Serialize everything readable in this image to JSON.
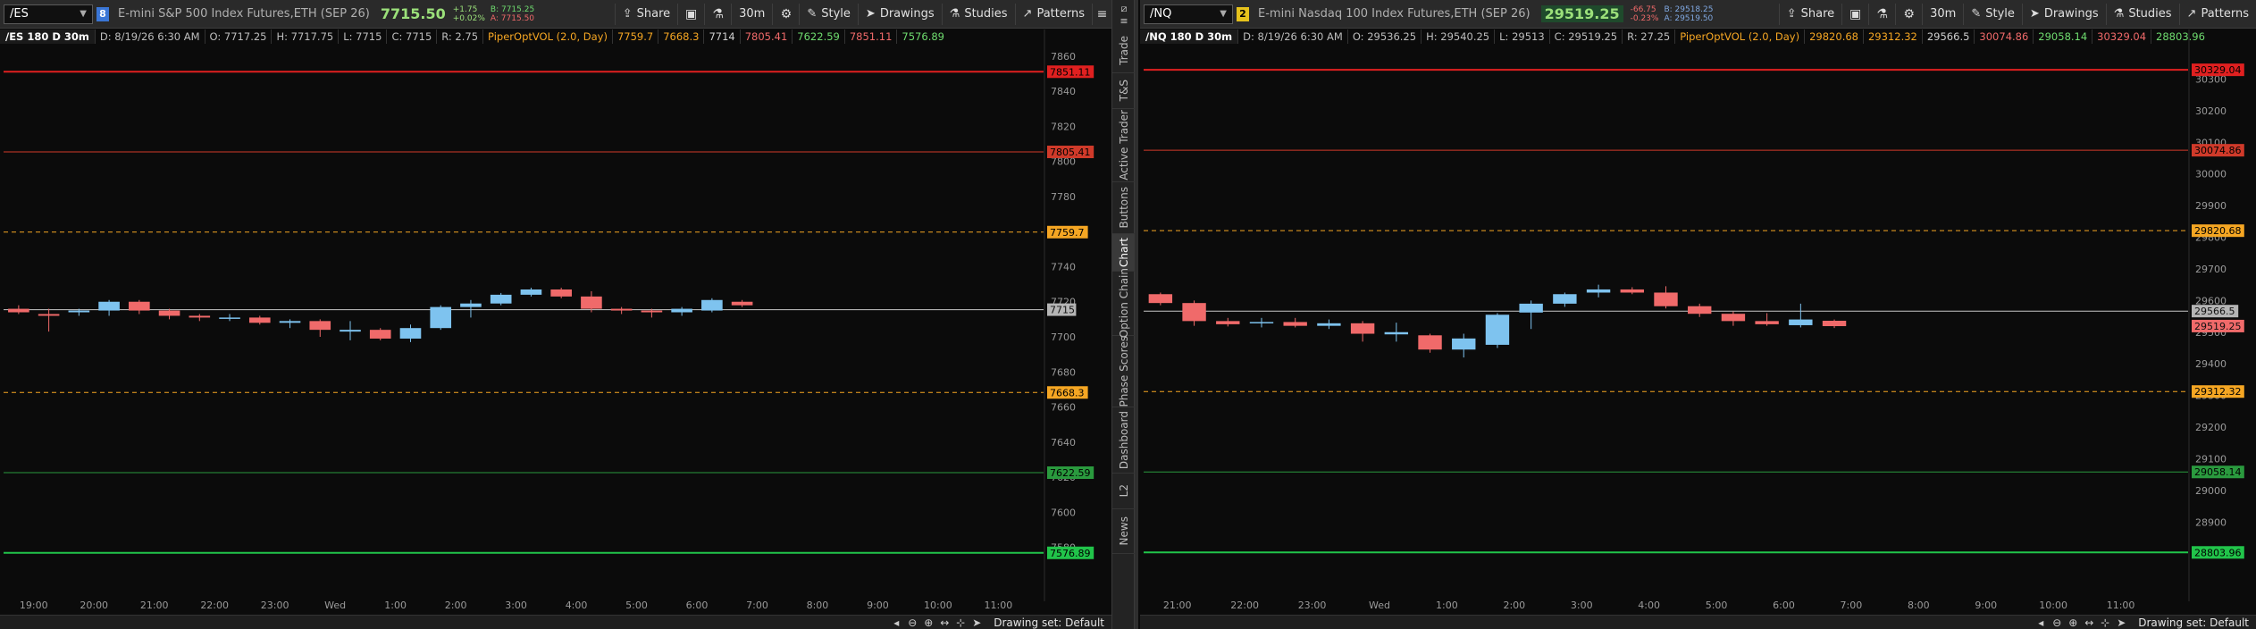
{
  "colors": {
    "up": "#7ec3ef",
    "down": "#f06a6a",
    "red_level": "#e02020",
    "orange_level": "#f5a623",
    "green_level": "#21c44a",
    "last_line": "#c8c8c8"
  },
  "charts": [
    {
      "id": "es",
      "symbol": "/ES",
      "link_badge": "8",
      "link_color": "#3a76d6",
      "description": "E-mini S&P 500 Index Futures,ETH (SEP 26)",
      "last_price": "7715.50",
      "net_change": "+1.75",
      "net_change_pct": "+0.02%",
      "bid": "B: 7715.25",
      "ask": "A: 7715.50",
      "timeframe": "30m",
      "share_label": "Share",
      "style_label": "Style",
      "drawings_label": "Drawings",
      "studies_label": "Studies",
      "patterns_label": "Patterns",
      "info": {
        "title": "/ES 180 D 30m",
        "date": "D: 8/19/26 6:30 AM",
        "open": "O: 7717.25",
        "high": "H: 7717.75",
        "low": "L: 7715",
        "close": "C: 7715",
        "range": "R: 2.75",
        "study": "PiperOptVOL (2.0, Day)",
        "levels_text": [
          "7759.7",
          "7668.3",
          "7714",
          "7805.41",
          "7622.59",
          "7851.11",
          "7576.89"
        ],
        "levels_colors": [
          "#f5a623",
          "#f5a623",
          "#cfcfcf",
          "#f06a6a",
          "#6fdc6f",
          "#f06a6a",
          "#6fdc6f"
        ]
      },
      "footer_label": "Drawing set: Default",
      "chart_data": {
        "type": "candlestick",
        "ylim": [
          7562,
          7865
        ],
        "y_ticks": [
          7860,
          7840,
          7820,
          7800,
          7780,
          7760,
          7740,
          7720,
          7700,
          7680,
          7660,
          7640,
          7620,
          7600,
          7580
        ],
        "x_tick_labels": [
          "19:00",
          "20:00",
          "21:00",
          "22:00",
          "23:00",
          "Wed",
          "1:00",
          "2:00",
          "3:00",
          "4:00",
          "5:00",
          "6:00",
          "7:00",
          "8:00",
          "9:00",
          "10:00",
          "11:00"
        ],
        "x_tick_slots": [
          0.5,
          2.5,
          4.5,
          6.5,
          8.5,
          10.5,
          12.5,
          14.5,
          16.5,
          18.5,
          20.5,
          22.5,
          24.5,
          26.5,
          28.5,
          30.5,
          32.5
        ],
        "slots_total": 34.5,
        "candles": [
          {
            "o": 7716,
            "h": 7718,
            "l": 7713,
            "c": 7714
          },
          {
            "o": 7713,
            "h": 7716,
            "l": 7703,
            "c": 7712
          },
          {
            "o": 7714,
            "h": 7716,
            "l": 7712,
            "c": 7715
          },
          {
            "o": 7715,
            "h": 7721,
            "l": 7712,
            "c": 7720
          },
          {
            "o": 7720,
            "h": 7721,
            "l": 7713,
            "c": 7715
          },
          {
            "o": 7715,
            "h": 7716,
            "l": 7710,
            "c": 7712
          },
          {
            "o": 7712,
            "h": 7713,
            "l": 7709,
            "c": 7711
          },
          {
            "o": 7711,
            "h": 7713,
            "l": 7709,
            "c": 7711
          },
          {
            "o": 7711,
            "h": 7712,
            "l": 7707,
            "c": 7708
          },
          {
            "o": 7708,
            "h": 7710,
            "l": 7705,
            "c": 7709
          },
          {
            "o": 7709,
            "h": 7710,
            "l": 7700,
            "c": 7704
          },
          {
            "o": 7703,
            "h": 7709,
            "l": 7698,
            "c": 7704
          },
          {
            "o": 7704,
            "h": 7705,
            "l": 7698,
            "c": 7699
          },
          {
            "o": 7699,
            "h": 7707,
            "l": 7697,
            "c": 7705
          },
          {
            "o": 7705,
            "h": 7718,
            "l": 7704,
            "c": 7717
          },
          {
            "o": 7717,
            "h": 7721,
            "l": 7711,
            "c": 7719
          },
          {
            "o": 7719,
            "h": 7725,
            "l": 7718,
            "c": 7724
          },
          {
            "o": 7724,
            "h": 7728,
            "l": 7723,
            "c": 7727
          },
          {
            "o": 7727,
            "h": 7728,
            "l": 7722,
            "c": 7723
          },
          {
            "o": 7723,
            "h": 7726,
            "l": 7714,
            "c": 7716
          },
          {
            "o": 7716,
            "h": 7717,
            "l": 7713,
            "c": 7715
          },
          {
            "o": 7715,
            "h": 7716,
            "l": 7711,
            "c": 7714
          },
          {
            "o": 7714,
            "h": 7717,
            "l": 7712,
            "c": 7716
          },
          {
            "o": 7715,
            "h": 7722,
            "l": 7714,
            "c": 7721
          },
          {
            "o": 7720,
            "h": 7721,
            "l": 7717,
            "c": 7718
          }
        ],
        "levels": [
          {
            "value": 7851.11,
            "label": "7851.11",
            "kind": "red"
          },
          {
            "value": 7805.41,
            "label": "7805.41",
            "kind": "red_thin"
          },
          {
            "value": 7759.7,
            "label": "7759.7",
            "kind": "orange_dash"
          },
          {
            "value": 7668.3,
            "label": "7668.3",
            "kind": "orange_dash"
          },
          {
            "value": 7622.59,
            "label": "7622.59",
            "kind": "green_thin"
          },
          {
            "value": 7576.89,
            "label": "7576.89",
            "kind": "green"
          }
        ],
        "last": {
          "value": 7715.5,
          "label": "7715"
        }
      }
    },
    {
      "id": "nq",
      "symbol": "/NQ",
      "link_badge": "2",
      "link_color": "#e6c21c",
      "description": "E-mini Nasdaq 100 Index Futures,ETH (SEP 26)",
      "last_price": "29519.25",
      "net_change": "-66.75",
      "net_change_pct": "-0.23%",
      "bid": "B: 29518.25",
      "ask": "A: 29519.50",
      "timeframe": "30m",
      "share_label": "Share",
      "style_label": "Style",
      "drawings_label": "Drawings",
      "studies_label": "Studies",
      "patterns_label": "Patterns",
      "info": {
        "title": "/NQ 180 D 30m",
        "date": "D: 8/19/26 6:30 AM",
        "open": "O: 29536.25",
        "high": "H: 29540.25",
        "low": "L: 29513",
        "close": "C: 29519.25",
        "range": "R: 27.25",
        "study": "PiperOptVOL (2.0, Day)",
        "levels_text": [
          "29820.68",
          "29312.32",
          "29566.5",
          "30074.86",
          "29058.14",
          "30329.04",
          "28803.96"
        ],
        "levels_colors": [
          "#f5a623",
          "#f5a623",
          "#cfcfcf",
          "#f06a6a",
          "#6fdc6f",
          "#f06a6a",
          "#6fdc6f"
        ]
      },
      "footer_label": "Drawing set: Default",
      "chart_data": {
        "type": "candlestick",
        "ylim": [
          28720,
          30400
        ],
        "y_ticks": [
          30300,
          30200,
          30100,
          30000,
          29900,
          29800,
          29700,
          29600,
          29500,
          29400,
          29300,
          29200,
          29100,
          29000,
          28900,
          28800
        ],
        "x_tick_labels": [
          "21:00",
          "22:00",
          "23:00",
          "Wed",
          "1:00",
          "2:00",
          "3:00",
          "4:00",
          "5:00",
          "6:00",
          "7:00",
          "8:00",
          "9:00",
          "10:00",
          "11:00"
        ],
        "x_tick_slots": [
          0.5,
          2.5,
          4.5,
          6.5,
          8.5,
          10.5,
          12.5,
          14.5,
          16.5,
          18.5,
          20.5,
          22.5,
          24.5,
          26.5,
          28.5
        ],
        "slots_total": 31,
        "candles": [
          {
            "o": 29620,
            "h": 29625,
            "l": 29585,
            "c": 29592
          },
          {
            "o": 29592,
            "h": 29600,
            "l": 29520,
            "c": 29535
          },
          {
            "o": 29535,
            "h": 29545,
            "l": 29518,
            "c": 29525
          },
          {
            "o": 29528,
            "h": 29545,
            "l": 29515,
            "c": 29532
          },
          {
            "o": 29532,
            "h": 29545,
            "l": 29515,
            "c": 29520
          },
          {
            "o": 29520,
            "h": 29540,
            "l": 29510,
            "c": 29528
          },
          {
            "o": 29528,
            "h": 29535,
            "l": 29470,
            "c": 29495
          },
          {
            "o": 29493,
            "h": 29530,
            "l": 29470,
            "c": 29500
          },
          {
            "o": 29490,
            "h": 29495,
            "l": 29435,
            "c": 29445
          },
          {
            "o": 29445,
            "h": 29495,
            "l": 29420,
            "c": 29480
          },
          {
            "o": 29460,
            "h": 29560,
            "l": 29450,
            "c": 29555
          },
          {
            "o": 29562,
            "h": 29600,
            "l": 29510,
            "c": 29590
          },
          {
            "o": 29590,
            "h": 29625,
            "l": 29580,
            "c": 29620
          },
          {
            "o": 29625,
            "h": 29650,
            "l": 29610,
            "c": 29635
          },
          {
            "o": 29635,
            "h": 29642,
            "l": 29620,
            "c": 29625
          },
          {
            "o": 29625,
            "h": 29645,
            "l": 29575,
            "c": 29582
          },
          {
            "o": 29582,
            "h": 29590,
            "l": 29548,
            "c": 29558
          },
          {
            "o": 29558,
            "h": 29565,
            "l": 29520,
            "c": 29535
          },
          {
            "o": 29535,
            "h": 29560,
            "l": 29520,
            "c": 29525
          },
          {
            "o": 29522,
            "h": 29590,
            "l": 29515,
            "c": 29540
          },
          {
            "o": 29536,
            "h": 29540,
            "l": 29513,
            "c": 29519
          }
        ],
        "levels": [
          {
            "value": 30329.04,
            "label": "30329.04",
            "kind": "red"
          },
          {
            "value": 30074.86,
            "label": "30074.86",
            "kind": "red_thin"
          },
          {
            "value": 29820.68,
            "label": "29820.68",
            "kind": "orange_dash"
          },
          {
            "value": 29312.32,
            "label": "29312.32",
            "kind": "orange_dash"
          },
          {
            "value": 29058.14,
            "label": "29058.14",
            "kind": "green_thin"
          },
          {
            "value": 28803.96,
            "label": "28803.96",
            "kind": "green"
          }
        ],
        "last": {
          "value": 29566.5,
          "label": "29566.5",
          "current": 29519.25,
          "current_label": "29519.25"
        }
      }
    }
  ],
  "sidebar": {
    "tabs": [
      "Trade",
      "T&S",
      "Active Trader",
      "Buttons",
      "Chart",
      "Option Chain",
      "Phase Scores",
      "Dashboard",
      "L2",
      "News"
    ],
    "active": "Chart"
  }
}
